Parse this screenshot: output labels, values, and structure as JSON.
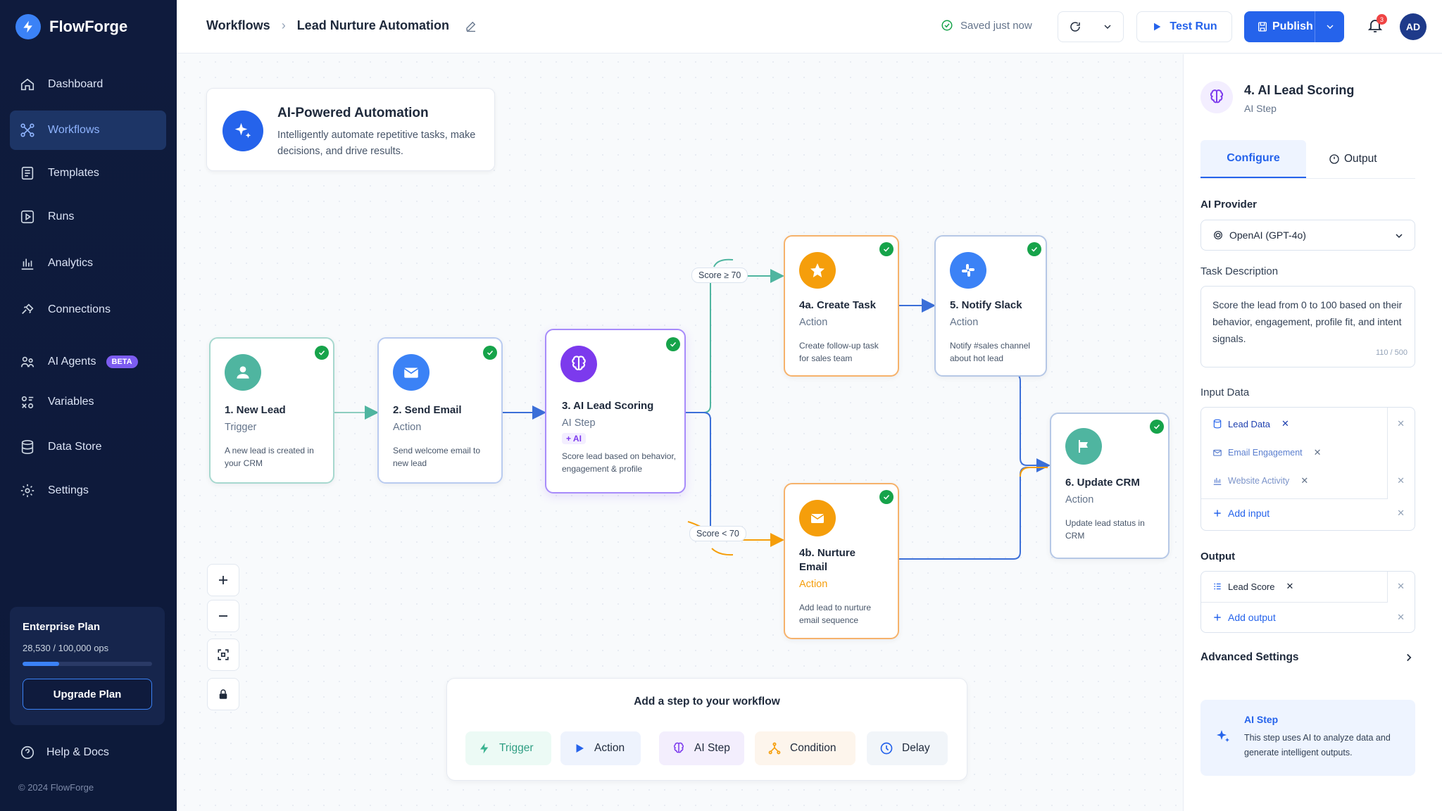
{
  "app": {
    "name": "FlowForge"
  },
  "sidebar": {
    "items": [
      {
        "label": "Dashboard"
      },
      {
        "label": "Workflows"
      },
      {
        "label": "Templates"
      },
      {
        "label": "Runs"
      },
      {
        "label": "Analytics"
      },
      {
        "label": "Connections"
      },
      {
        "label": "AI Agents",
        "badge": "BETA"
      },
      {
        "label": "Variables"
      },
      {
        "label": "Data Store"
      },
      {
        "label": "Settings"
      }
    ],
    "plan": {
      "title": "Enterprise Plan",
      "ops": "28,530 / 100,000 ops",
      "usage_fraction": 0.2853,
      "button": "Upgrade Plan"
    },
    "help": "Help & Docs",
    "copyright": "© 2024 FlowForge"
  },
  "header": {
    "breadcrumb_root": "Workflows",
    "breadcrumb_current": "Lead Nurture Automation",
    "saved": "Saved just now",
    "test_run": "Test Run",
    "publish": "Publish",
    "notifications": "3",
    "avatar": "AD"
  },
  "canvas": {
    "info": {
      "title": "AI-Powered Automation",
      "desc": "Intelligently automate repetitive tasks, make decisions, and drive results."
    },
    "nodes": [
      {
        "title": "1. New Lead",
        "type": "Trigger",
        "desc": "A new lead is created in your CRM"
      },
      {
        "title": "2. Send Email",
        "type": "Action",
        "desc": "Send welcome email to new lead"
      },
      {
        "title": "3. AI Lead Scoring",
        "type": "AI Step",
        "tag": "AI",
        "desc": "Score lead based on behavior, engagement & profile"
      },
      {
        "title": "4a. Create Task",
        "type": "Action",
        "desc": "Create follow-up task for sales team"
      },
      {
        "title": "5. Notify Slack",
        "type": "Action",
        "desc": "Notify #sales channel about hot lead"
      },
      {
        "title": "4b. Nurture Email",
        "type": "Action",
        "desc": "Add lead to nurture email sequence"
      },
      {
        "title": "6. Update CRM",
        "type": "Action",
        "desc": "Update lead status in CRM"
      }
    ],
    "edge_labels": {
      "high": "Score ≥ 70",
      "low": "Score < 70"
    },
    "add_step": {
      "title": "Add a step to your workflow",
      "buttons": [
        "Trigger",
        "Action",
        "AI Step",
        "Condition",
        "Delay"
      ]
    }
  },
  "panel": {
    "title": "4. AI Lead Scoring",
    "subtitle": "AI Step",
    "tabs": [
      "Configure",
      "Output"
    ],
    "provider_label": "AI Provider",
    "provider_value": "OpenAI (GPT-4o)",
    "task_label": "Task Description",
    "task_value": "Score the lead from 0 to 100 based on their behavior, engagement, profile fit, and intent signals.",
    "task_count": "110 / 500",
    "input_label": "Input Data",
    "inputs": [
      "Lead Data",
      "Email Engagement",
      "Website Activity"
    ],
    "add_input": "Add input",
    "output_label": "Output",
    "outputs": [
      "Lead Score"
    ],
    "add_output": "Add output",
    "advanced": "Advanced Settings",
    "note_title": "AI Step",
    "note_desc": "This step uses AI to analyze data and generate intelligent outputs."
  },
  "colors": {
    "accent": "#2563eb",
    "sidebar": "#0f1b3d",
    "success": "#16a34a",
    "ai": "#7c3aed",
    "orange": "#f59e0b",
    "teal": "#4fb5a0"
  }
}
